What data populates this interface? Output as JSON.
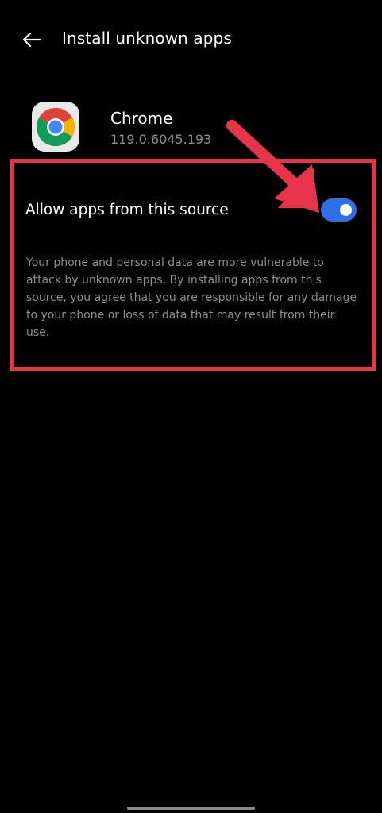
{
  "header": {
    "title": "Install unknown apps",
    "back_icon": "arrow-left-icon"
  },
  "app": {
    "name": "Chrome",
    "version": "119.0.6045.193",
    "icon": "chrome-icon"
  },
  "setting": {
    "label": "Allow apps from this source",
    "enabled": true,
    "description": "Your phone and personal data are more vulnerable to attack by unknown apps. By installing apps from this source, you agree that you are responsible for any damage to your phone or loss of data that may result from their use."
  },
  "colors": {
    "background": "#000000",
    "toggle_on": "#2f6fe6",
    "annotation": "#e8344a",
    "secondary_text": "#8e8e8e"
  }
}
